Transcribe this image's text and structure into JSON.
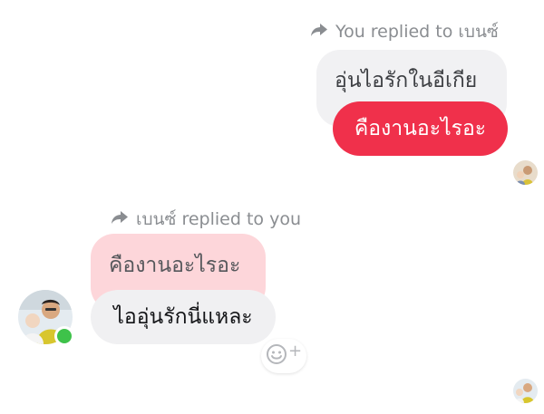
{
  "outgoing": {
    "reply_caption": "You replied to เบนซ์",
    "quoted_text": "อุ่นไอรักในอีเกีย",
    "message_text": "คืองานอะไรอะ",
    "bubble_color": "#f0304b"
  },
  "incoming": {
    "reply_caption": "เบนซ์ replied to you",
    "quoted_text": "คืองานอะไรอะ",
    "message_text": "ไออุ่นรักนี่แหละ",
    "sender_online": true
  },
  "icons": {
    "reply": "reply-arrow-icon",
    "reaction": "add-reaction-icon",
    "reaction_plus": "+"
  },
  "colors": {
    "caption": "#8a8d91",
    "quoted_outgoing_bg": "#f1f1f3",
    "quoted_incoming_bg": "#fdd6da",
    "incoming_bg": "#f0f0f2",
    "online": "#3ec24a"
  }
}
